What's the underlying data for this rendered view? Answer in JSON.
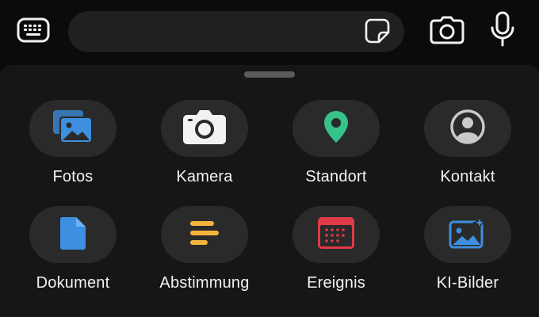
{
  "input": {
    "placeholder": "",
    "value": ""
  },
  "icons": {
    "keyboard": "keyboard-icon",
    "sticker": "sticker-icon",
    "camera": "camera-icon",
    "mic": "microphone-icon"
  },
  "attachments": [
    {
      "label": "Fotos",
      "icon": "photos-icon",
      "color": "#3d8fe0"
    },
    {
      "label": "Kamera",
      "icon": "camera-icon",
      "color": "#f2f2f2"
    },
    {
      "label": "Standort",
      "icon": "location-pin-icon",
      "color": "#36c28a"
    },
    {
      "label": "Kontakt",
      "icon": "contact-icon",
      "color": "#b8b8b8"
    },
    {
      "label": "Dokument",
      "icon": "document-icon",
      "color": "#3d8fe0"
    },
    {
      "label": "Abstimmung",
      "icon": "poll-icon",
      "color": "#f4b43c"
    },
    {
      "label": "Ereignis",
      "icon": "calendar-event-icon",
      "color": "#e03a46"
    },
    {
      "label": "KI-Bilder",
      "icon": "ai-images-icon",
      "color": "#3d8fe0"
    }
  ]
}
